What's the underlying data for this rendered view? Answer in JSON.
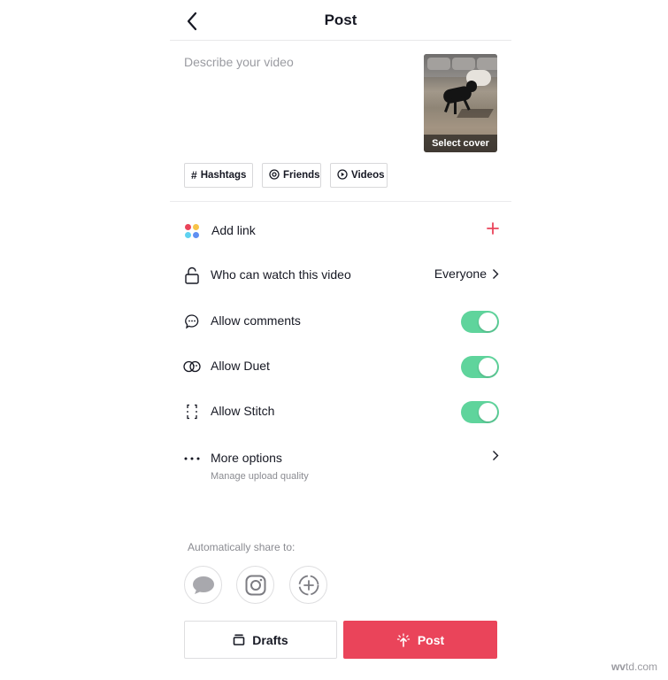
{
  "header": {
    "title": "Post",
    "back_icon": "chevron-left-icon"
  },
  "description": {
    "placeholder": "Describe your video"
  },
  "cover": {
    "label": "Select cover"
  },
  "chips": [
    {
      "label": "Hashtags",
      "icon": "hash-icon",
      "glyph": "#"
    },
    {
      "label": "Friends",
      "icon": "at-icon",
      "glyph": "@"
    },
    {
      "label": "Videos",
      "icon": "play-circle-icon",
      "glyph": "▶"
    }
  ],
  "rows": {
    "add_link": {
      "label": "Add link",
      "action_glyph": "+"
    },
    "who_can_watch": {
      "label": "Who can watch this video",
      "value": "Everyone"
    },
    "allow_comments": {
      "label": "Allow comments",
      "enabled": true
    },
    "allow_duet": {
      "label": "Allow Duet",
      "enabled": true
    },
    "allow_stitch": {
      "label": "Allow Stitch",
      "enabled": true
    },
    "more_options": {
      "label": "More options",
      "sublabel": "Manage upload quality"
    }
  },
  "share": {
    "label": "Automatically share to:",
    "targets": [
      "message-icon",
      "instagram-icon",
      "add-story-icon"
    ]
  },
  "buttons": {
    "drafts": "Drafts",
    "post": "Post"
  },
  "colors": {
    "accent": "#ea445a",
    "toggle_on": "#5fd49c"
  },
  "watermark": {
    "bold": "wv",
    "rest": "td.com"
  }
}
